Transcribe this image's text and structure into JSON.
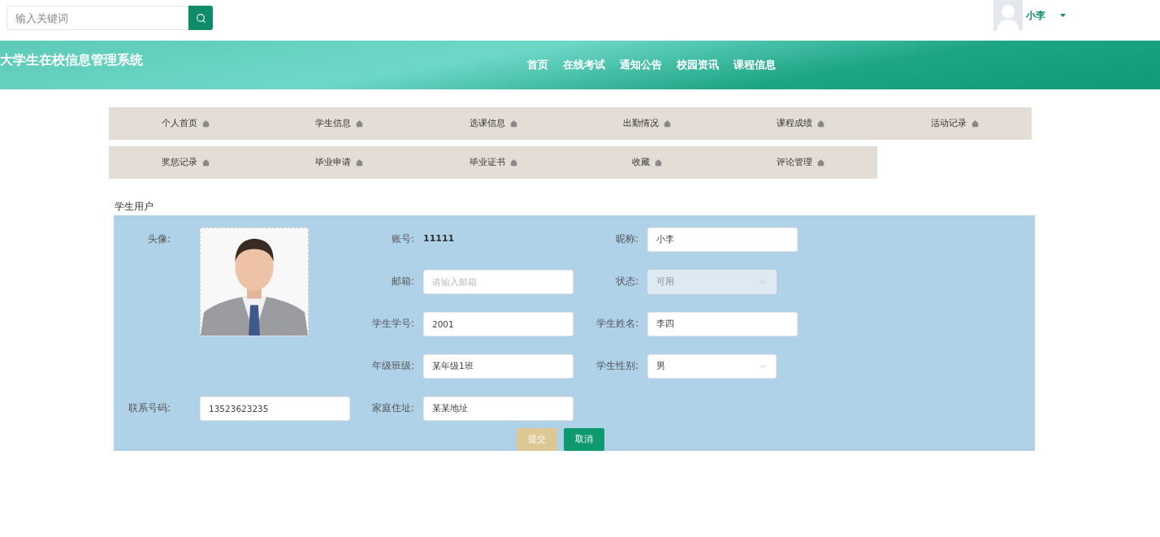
{
  "topbar": {
    "search": {
      "placeholder": "输入关键词"
    },
    "user": {
      "name": "小李"
    }
  },
  "banner": {
    "title": "大学生在校信息管理系统",
    "nav": [
      {
        "label": "首页"
      },
      {
        "label": "在线考试"
      },
      {
        "label": "通知公告"
      },
      {
        "label": "校园资讯"
      },
      {
        "label": "课程信息"
      }
    ]
  },
  "menu": [
    [
      {
        "label": "个人首页"
      },
      {
        "label": "学生信息"
      },
      {
        "label": "选课信息"
      },
      {
        "label": "出勤情况"
      },
      {
        "label": "课程成绩"
      },
      {
        "label": "活动记录"
      }
    ],
    [
      {
        "label": "奖惩记录"
      },
      {
        "label": "毕业申请"
      },
      {
        "label": "毕业证书"
      },
      {
        "label": "收藏"
      },
      {
        "label": "评论管理"
      }
    ]
  ],
  "form": {
    "title": "学生用户",
    "fields": [
      {
        "label": "头像:"
      },
      {
        "label": "账号:",
        "kind": "text",
        "value": "11111"
      },
      {
        "label": "昵称:",
        "kind": "input",
        "value": "小李"
      },
      {
        "label": "邮箱:",
        "kind": "input",
        "placeholder": "请输入邮箱"
      },
      {
        "label": "状态:",
        "kind": "select",
        "value": "可用",
        "disabled": true
      },
      {
        "label": "学生学号:",
        "kind": "input",
        "value": "2001"
      },
      {
        "label": "学生姓名:",
        "kind": "input",
        "value": "李四"
      },
      {
        "label": "年级班级:",
        "kind": "input",
        "value": "某年级1班"
      },
      {
        "label": "学生性别:",
        "kind": "select",
        "value": "男",
        "disabled": false
      },
      {
        "label": "联系号码:",
        "kind": "input",
        "value": "13523623235"
      },
      {
        "label": "家庭住址:",
        "kind": "input",
        "value": "某某地址"
      }
    ],
    "buttons": [
      {
        "label": "提交",
        "kind": "submit"
      },
      {
        "label": "取消",
        "kind": "cancel"
      }
    ]
  }
}
